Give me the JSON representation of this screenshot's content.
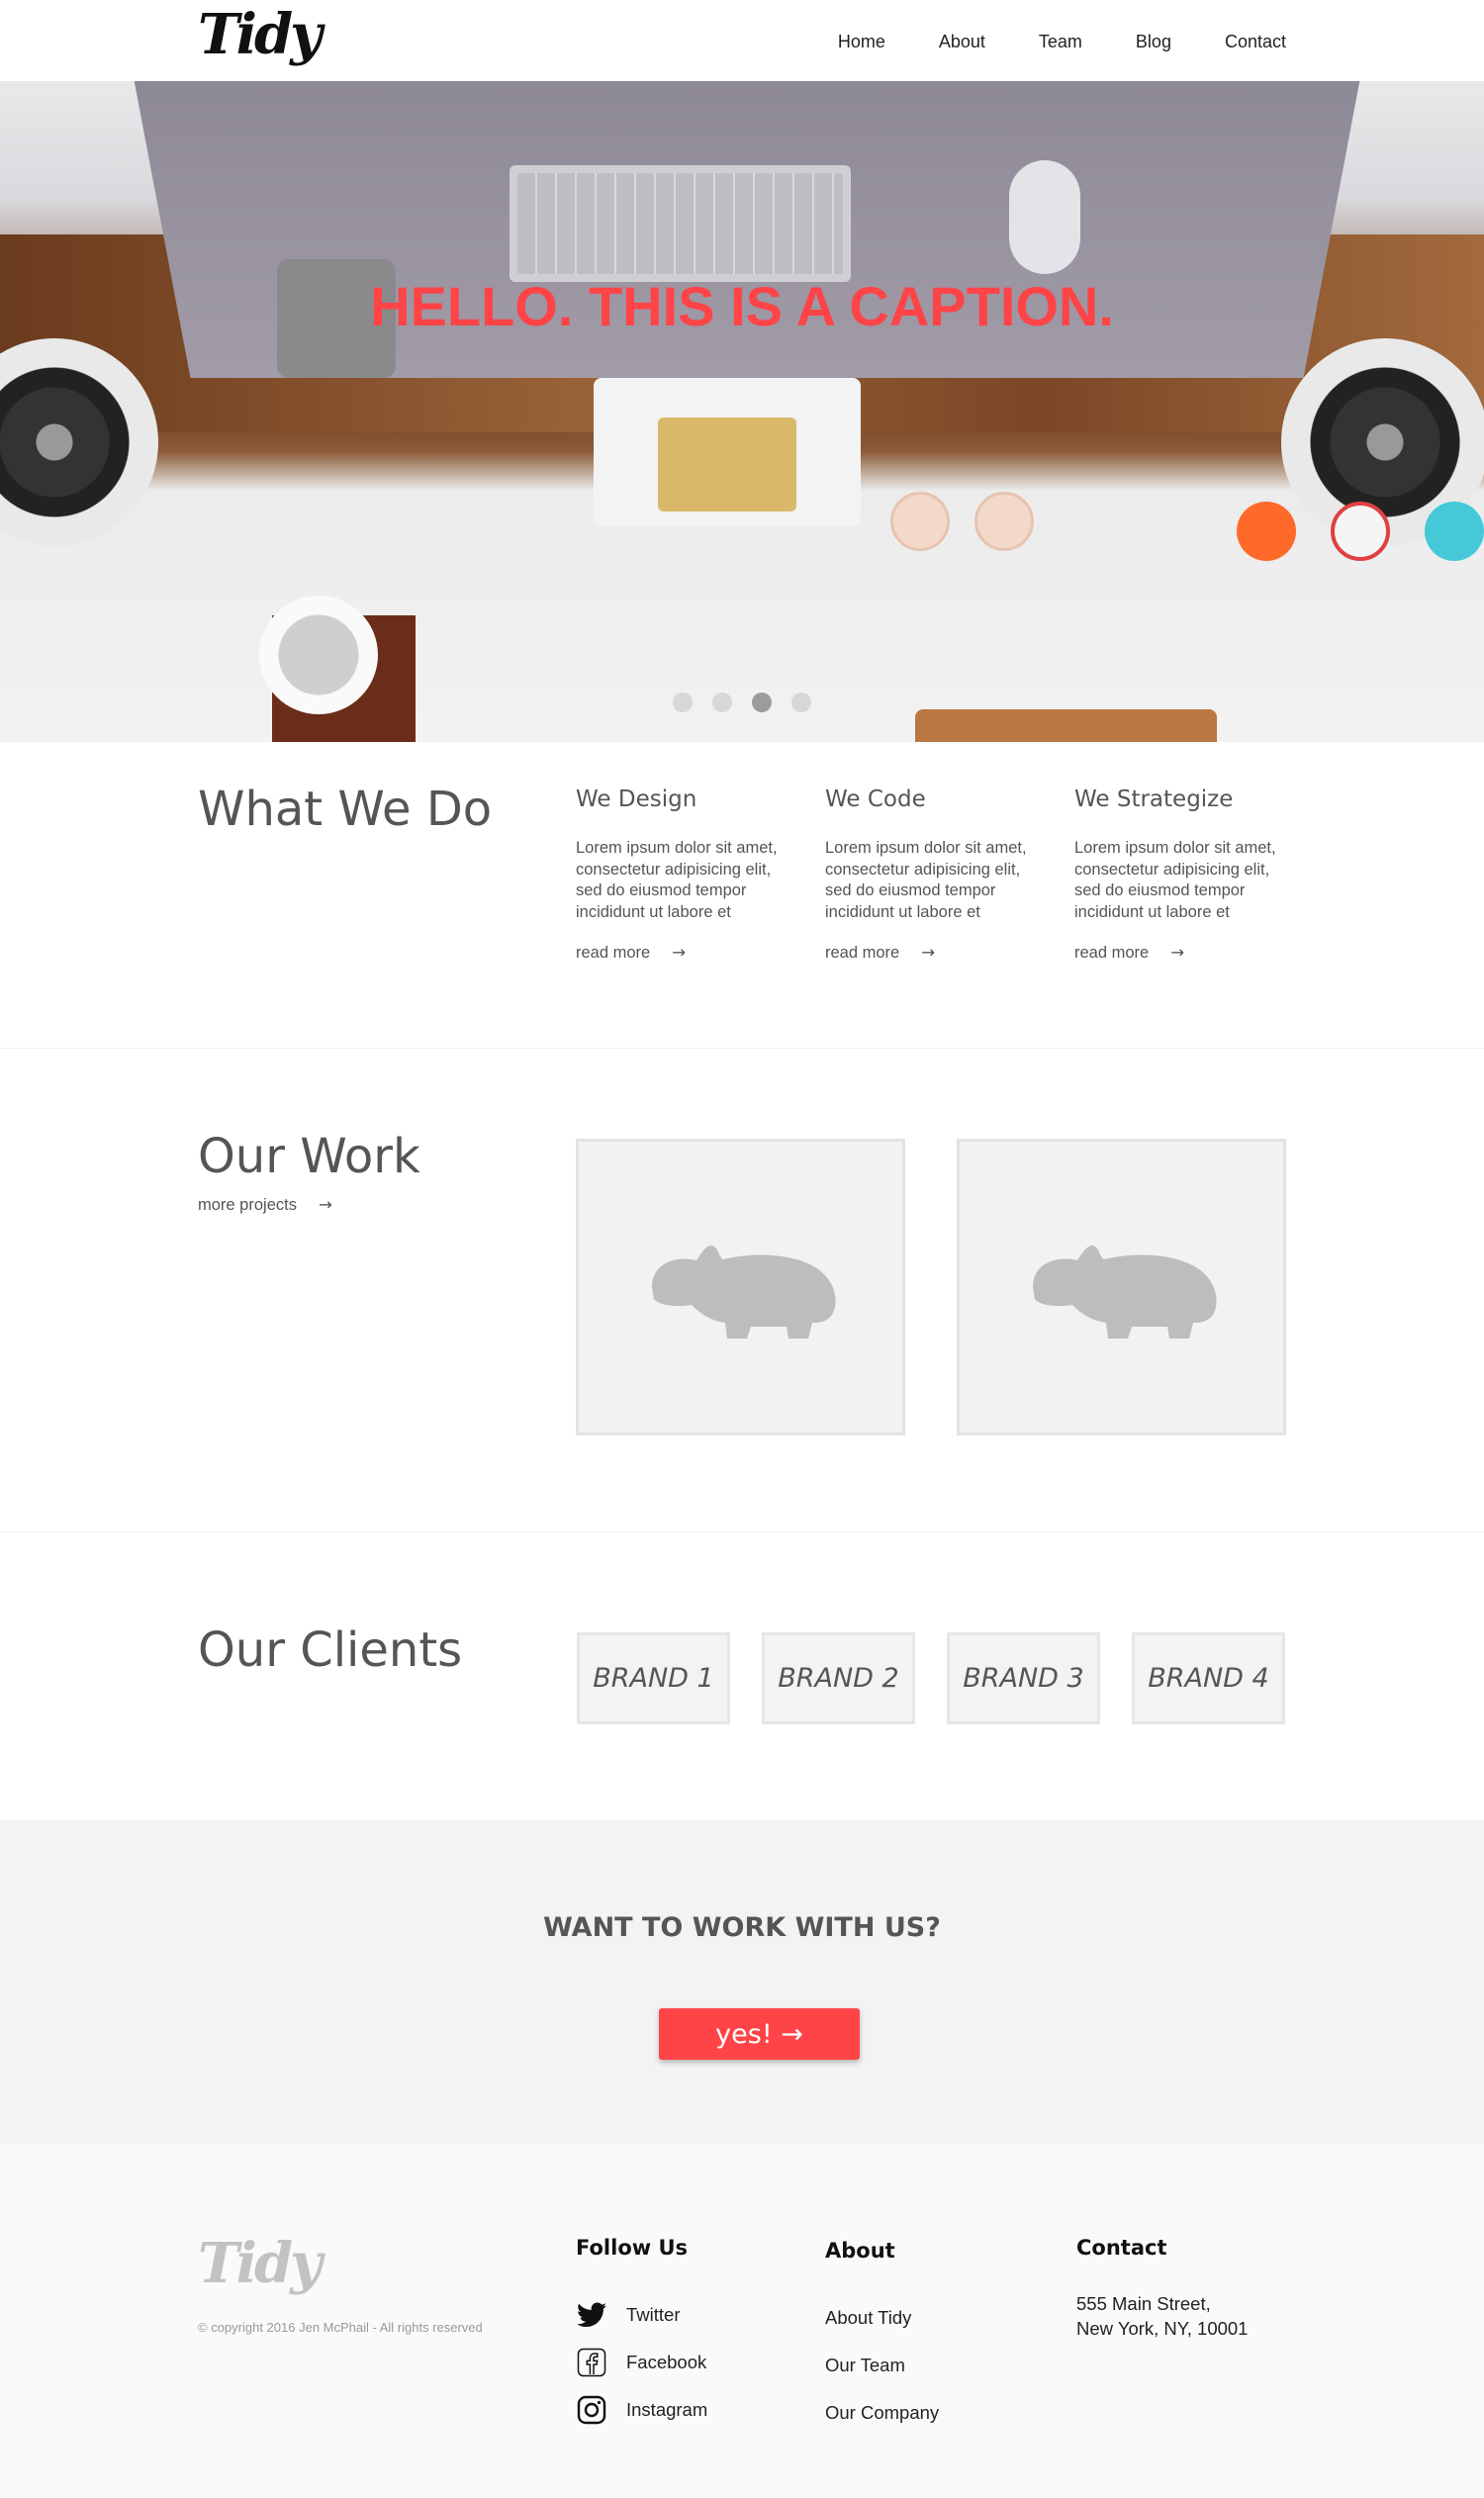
{
  "header": {
    "logo": "Tidy",
    "nav": [
      "Home",
      "About",
      "Team",
      "Blog",
      "Contact"
    ]
  },
  "hero": {
    "caption": "HELLO. THIS IS A CAPTION.",
    "carousel": {
      "slides": 4,
      "active_index": 2
    }
  },
  "what_we_do": {
    "title": "What We Do",
    "services": [
      {
        "title": "We Design",
        "text": "Lorem ipsum dolor sit amet, consectetur adipisicing elit, sed do eiusmod tempor incididunt ut labore et",
        "link": "read more",
        "arrow": "→"
      },
      {
        "title": "We Code",
        "text": "Lorem ipsum dolor sit amet, consectetur adipisicing elit, sed do eiusmod tempor incididunt ut labore et",
        "link": "read more",
        "arrow": "→"
      },
      {
        "title": "We Strategize",
        "text": "Lorem ipsum dolor sit amet, consectetur adipisicing elit, sed do eiusmod tempor incididunt ut labore et",
        "link": "read more",
        "arrow": "→"
      }
    ]
  },
  "our_work": {
    "title": "Our Work",
    "more_link": "more projects",
    "arrow": "→",
    "projects": [
      {
        "icon": "hippo-placeholder-icon"
      },
      {
        "icon": "hippo-placeholder-icon"
      }
    ]
  },
  "clients": {
    "title": "Our Clients",
    "brands": [
      "BRAND 1",
      "BRAND 2",
      "BRAND 3",
      "BRAND 4"
    ]
  },
  "cta": {
    "heading": "WANT TO WORK WITH US?",
    "button_label": "yes! →"
  },
  "footer": {
    "logo": "Tidy",
    "copyright": "© copyright 2016 Jen McPhail - All rights reserved",
    "follow": {
      "heading": "Follow Us",
      "links": [
        {
          "label": "Twitter",
          "icon": "twitter-icon"
        },
        {
          "label": "Facebook",
          "icon": "facebook-icon"
        },
        {
          "label": "Instagram",
          "icon": "instagram-icon"
        }
      ]
    },
    "about": {
      "heading": "About",
      "links": [
        "About Tidy",
        "Our Team",
        "Our Company"
      ]
    },
    "contact": {
      "heading": "Contact",
      "address_line1": "555 Main Street,",
      "address_line2": "New York, NY, 10001"
    }
  },
  "colors": {
    "accent": "#ff4448",
    "text": "#555555",
    "panel": "#f3f3f3"
  }
}
